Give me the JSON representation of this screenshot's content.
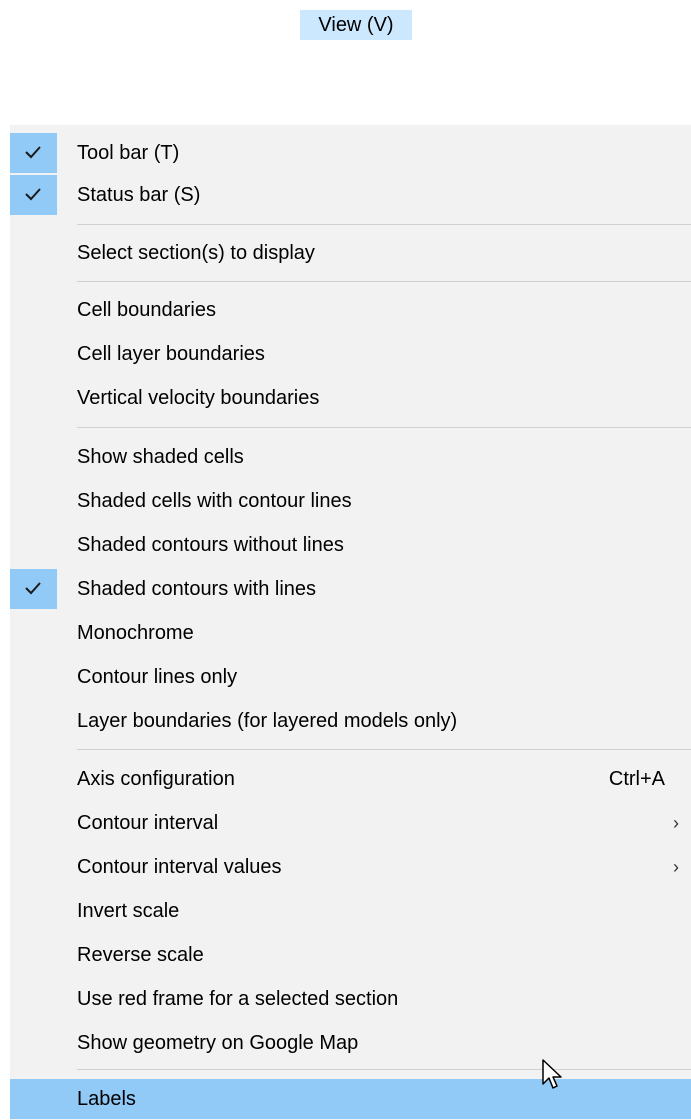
{
  "menubar": {
    "view_label": "View (V)"
  },
  "colors": {
    "highlight": "#91c9f7",
    "menubar_highlight": "#cce8ff",
    "menu_bg": "#f2f2f2"
  },
  "menu": {
    "items": [
      {
        "label": "Tool bar (T)",
        "checked": true
      },
      {
        "label": "Status bar (S)",
        "checked": true
      },
      {
        "label": "Select section(s) to display"
      },
      {
        "label": "Cell boundaries"
      },
      {
        "label": "Cell layer boundaries"
      },
      {
        "label": "Vertical velocity boundaries"
      },
      {
        "label": "Show shaded cells"
      },
      {
        "label": "Shaded cells with contour lines"
      },
      {
        "label": "Shaded contours without lines"
      },
      {
        "label": "Shaded contours with lines",
        "checked": true
      },
      {
        "label": "Monochrome"
      },
      {
        "label": "Contour lines only"
      },
      {
        "label": "Layer boundaries (for layered models only)"
      },
      {
        "label": "Axis configuration",
        "shortcut": "Ctrl+A"
      },
      {
        "label": "Contour interval",
        "submenu": true
      },
      {
        "label": "Contour interval values",
        "submenu": true
      },
      {
        "label": "Invert scale"
      },
      {
        "label": "Reverse scale"
      },
      {
        "label": "Use red frame for a selected section"
      },
      {
        "label": "Show geometry on Google Map"
      },
      {
        "label": "Labels",
        "highlighted": true
      }
    ],
    "submenu_arrow": "›"
  }
}
